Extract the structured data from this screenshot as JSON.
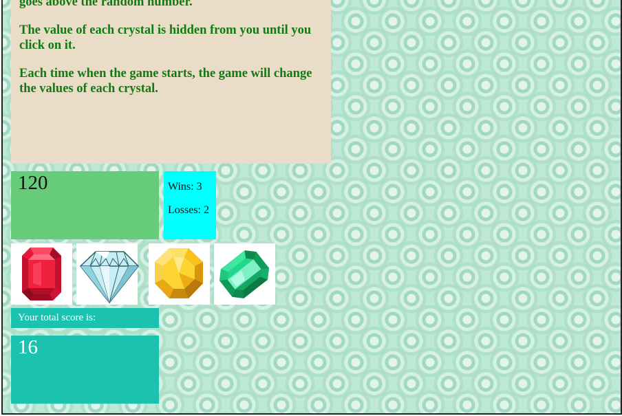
{
  "instructions": {
    "line_partial": "goes above the random number.",
    "hidden_value": "The value of each crystal is hidden from you until you click on it.",
    "change_values": "Each time when the game starts, the game will change the values of each crystal."
  },
  "target_number": "120",
  "stats": {
    "wins": "Wins: 3",
    "losses": "Losses: 2"
  },
  "crystals": [
    {
      "icon": "red-crystal-icon",
      "color": "#e8193c"
    },
    {
      "icon": "diamond-icon",
      "color": "#8fd3e0"
    },
    {
      "icon": "yellow-crystal-icon",
      "color": "#f6c21b"
    },
    {
      "icon": "green-crystal-icon",
      "color": "#1ec77a"
    }
  ],
  "score": {
    "label": "Your total score is:",
    "value": "16"
  },
  "colors": {
    "instructions_bg": "#eaddc7",
    "instructions_text": "#137a13",
    "target_bg": "#66cc7a",
    "stats_bg": "#00ffff",
    "score_bg": "#1bc2b0"
  }
}
